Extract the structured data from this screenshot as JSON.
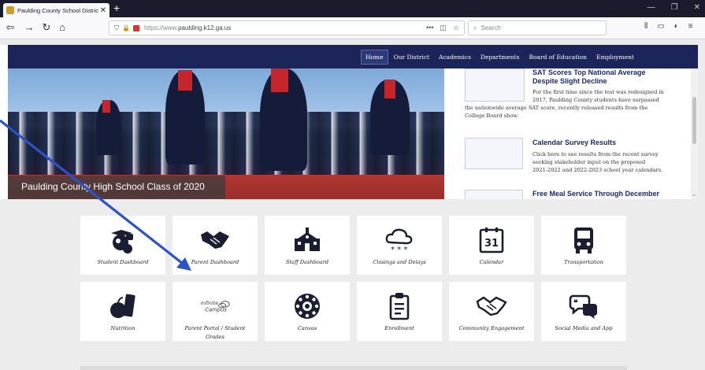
{
  "browser": {
    "tab_title": "Paulding County School Distric",
    "url_host": "https://www.",
    "url_domain": "paulding.k12.ga.us",
    "search_placeholder": "Search"
  },
  "site_nav": {
    "items": [
      "Home",
      "Our District",
      "Academics",
      "Departments",
      "Board of Education",
      "Employment"
    ]
  },
  "hero": {
    "caption": "Paulding County High School Class of 2020"
  },
  "news": [
    {
      "title_line1": "SAT Scores Top National Average",
      "title_line2": "Despite Slight Decline",
      "body": [
        "For the first time since the test was redesigned in",
        "2017, Paulding County students have surpassed",
        "the nationwide average SAT score, recently released results from the",
        "College Board show."
      ]
    },
    {
      "title_line1": "Calendar Survey Results",
      "body": [
        "Click here to see results from the recent survey",
        "seeking stakeholder input on the proposed",
        "2021-2022 and 2022-2023 school year calendars."
      ]
    },
    {
      "title_line1": "Free Meal Service Through December"
    }
  ],
  "tiles": [
    {
      "label": "Student Dashboard",
      "icon": "student-icon"
    },
    {
      "label": "Parent Dashboard",
      "icon": "handshake-icon"
    },
    {
      "label": "Staff Dashboard",
      "icon": "school-building-icon"
    },
    {
      "label": "Closings and Delays",
      "icon": "snow-cloud-icon"
    },
    {
      "label": "Calendar",
      "icon": "calendar-icon",
      "icon_text": "31"
    },
    {
      "label": "Transportation",
      "icon": "bus-icon"
    },
    {
      "label": "Nutrition",
      "icon": "apple-icon"
    },
    {
      "label": "Parent Portal / Student",
      "label2": "Grades",
      "icon": "infinite-campus-logo",
      "logo_line1": "Infinite",
      "logo_line2": "Campus"
    },
    {
      "label": "Canvas",
      "icon": "canvas-icon"
    },
    {
      "label": "Enrollment",
      "icon": "clipboard-icon"
    },
    {
      "label": "Community Engagement",
      "icon": "handshake-outline-icon"
    },
    {
      "label": "Social Media and App",
      "icon": "chat-bubbles-icon"
    }
  ]
}
